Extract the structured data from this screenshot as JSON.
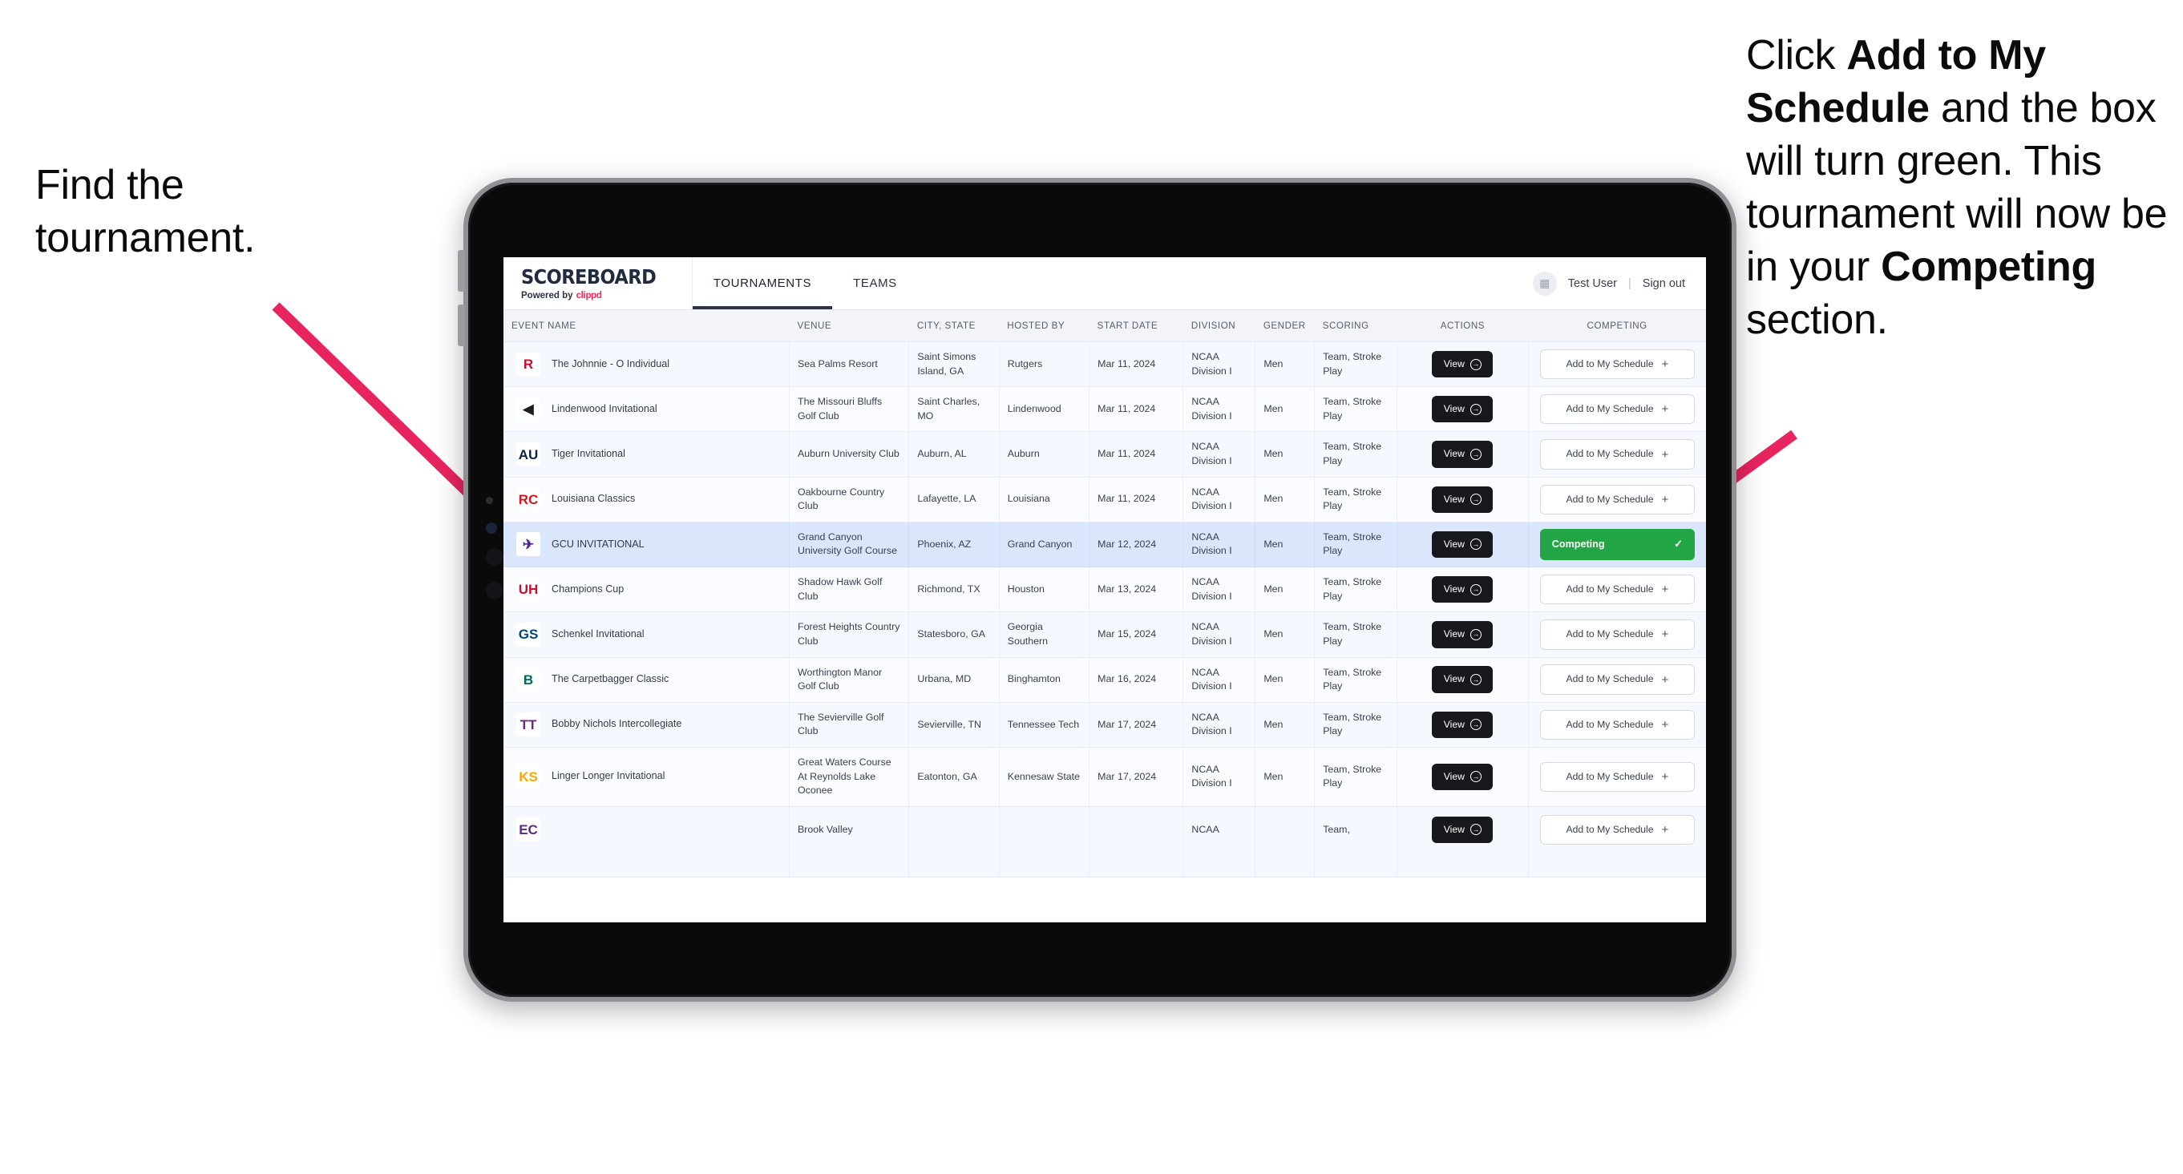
{
  "annotations": {
    "left": {
      "text": "Find the tournament."
    },
    "right": {
      "part1": "Click ",
      "bold1": "Add to My Schedule",
      "part2": " and the box will turn green. This tournament will now be in your ",
      "bold2": "Competing",
      "part3": " section."
    }
  },
  "colors": {
    "arrow": "#e8245f",
    "accent_pink": "#ec2a62",
    "competing_green": "#22a544",
    "selected_row": "#d9e6fb",
    "dark_button": "#16181c"
  },
  "app": {
    "brand": {
      "title": "SCOREBOARD",
      "powered_prefix": "Powered by",
      "powered_brand": "clippd"
    },
    "tabs": [
      {
        "label": "TOURNAMENTS",
        "active": true
      },
      {
        "label": "TEAMS",
        "active": false
      }
    ],
    "user": {
      "avatar_icon": "user-avatar-icon",
      "name": "Test User",
      "separator": "|",
      "signout": "Sign out"
    }
  },
  "table": {
    "headers": [
      "EVENT NAME",
      "VENUE",
      "CITY, STATE",
      "HOSTED BY",
      "START DATE",
      "DIVISION",
      "GENDER",
      "SCORING",
      "ACTIONS",
      "COMPETING"
    ],
    "view_label": "View",
    "add_label": "Add to My Schedule",
    "add_plus": "+",
    "competing_label": "Competing",
    "competing_check": "✓",
    "rows": [
      {
        "logo": {
          "text": "R",
          "bg": "#ffffff",
          "color": "#c8102e"
        },
        "event": "The Johnnie - O Individual",
        "venue": "Sea Palms Resort",
        "city": "Saint Simons Island, GA",
        "hosted_by": "Rutgers",
        "start_date": "Mar 11, 2024",
        "division": "NCAA Division I",
        "gender": "Men",
        "scoring": "Team, Stroke Play",
        "competing": false
      },
      {
        "logo": {
          "text": "◀",
          "bg": "#ffffff",
          "color": "#1d1d1b"
        },
        "event": "Lindenwood Invitational",
        "venue": "The Missouri Bluffs Golf Club",
        "city": "Saint Charles, MO",
        "hosted_by": "Lindenwood",
        "start_date": "Mar 11, 2024",
        "division": "NCAA Division I",
        "gender": "Men",
        "scoring": "Team, Stroke Play",
        "competing": false
      },
      {
        "logo": {
          "text": "AU",
          "bg": "#ffffff",
          "color": "#0c2340"
        },
        "event": "Tiger Invitational",
        "venue": "Auburn University Club",
        "city": "Auburn, AL",
        "hosted_by": "Auburn",
        "start_date": "Mar 11, 2024",
        "division": "NCAA Division I",
        "gender": "Men",
        "scoring": "Team, Stroke Play",
        "competing": false
      },
      {
        "logo": {
          "text": "RC",
          "bg": "#ffffff",
          "color": "#ce181e"
        },
        "event": "Louisiana Classics",
        "venue": "Oakbourne Country Club",
        "city": "Lafayette, LA",
        "hosted_by": "Louisiana",
        "start_date": "Mar 11, 2024",
        "division": "NCAA Division I",
        "gender": "Men",
        "scoring": "Team, Stroke Play",
        "competing": false
      },
      {
        "logo": {
          "text": "✈",
          "bg": "#ffffff",
          "color": "#522398"
        },
        "event": "GCU INVITATIONAL",
        "venue": "Grand Canyon University Golf Course",
        "city": "Phoenix, AZ",
        "hosted_by": "Grand Canyon",
        "start_date": "Mar 12, 2024",
        "division": "NCAA Division I",
        "gender": "Men",
        "scoring": "Team, Stroke Play",
        "competing": true
      },
      {
        "logo": {
          "text": "UH",
          "bg": "#ffffff",
          "color": "#c8102e"
        },
        "event": "Champions Cup",
        "venue": "Shadow Hawk Golf Club",
        "city": "Richmond, TX",
        "hosted_by": "Houston",
        "start_date": "Mar 13, 2024",
        "division": "NCAA Division I",
        "gender": "Men",
        "scoring": "Team, Stroke Play",
        "competing": false
      },
      {
        "logo": {
          "text": "GS",
          "bg": "#ffffff",
          "color": "#00457c"
        },
        "event": "Schenkel Invitational",
        "venue": "Forest Heights Country Club",
        "city": "Statesboro, GA",
        "hosted_by": "Georgia Southern",
        "start_date": "Mar 15, 2024",
        "division": "NCAA Division I",
        "gender": "Men",
        "scoring": "Team, Stroke Play",
        "competing": false
      },
      {
        "logo": {
          "text": "B",
          "bg": "#ffffff",
          "color": "#00695c"
        },
        "event": "The Carpetbagger Classic",
        "venue": "Worthington Manor Golf Club",
        "city": "Urbana, MD",
        "hosted_by": "Binghamton",
        "start_date": "Mar 16, 2024",
        "division": "NCAA Division I",
        "gender": "Men",
        "scoring": "Team, Stroke Play",
        "competing": false
      },
      {
        "logo": {
          "text": "TT",
          "bg": "#ffffff",
          "color": "#6a2a7a"
        },
        "event": "Bobby Nichols Intercollegiate",
        "venue": "The Sevierville Golf Club",
        "city": "Sevierville, TN",
        "hosted_by": "Tennessee Tech",
        "start_date": "Mar 17, 2024",
        "division": "NCAA Division I",
        "gender": "Men",
        "scoring": "Team, Stroke Play",
        "competing": false
      },
      {
        "logo": {
          "text": "KS",
          "bg": "#ffffff",
          "color": "#f5a800"
        },
        "event": "Linger Longer Invitational",
        "venue": "Great Waters Course At Reynolds Lake Oconee",
        "city": "Eatonton, GA",
        "hosted_by": "Kennesaw State",
        "start_date": "Mar 17, 2024",
        "division": "NCAA Division I",
        "gender": "Men",
        "scoring": "Team, Stroke Play",
        "competing": false
      },
      {
        "logo": {
          "text": "EC",
          "bg": "#ffffff",
          "color": "#592a8a"
        },
        "event": "",
        "venue": "Brook Valley",
        "city": "",
        "hosted_by": "",
        "start_date": "",
        "division": "NCAA",
        "gender": "",
        "scoring": "Team,",
        "competing": false,
        "clipped": true
      }
    ]
  }
}
